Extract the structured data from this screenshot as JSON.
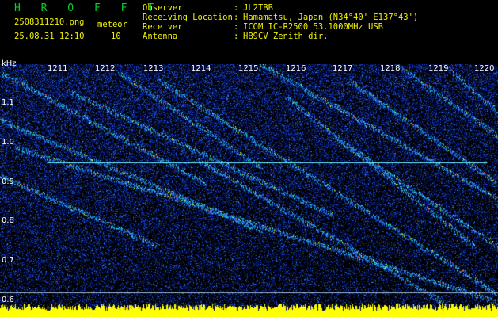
{
  "header": {
    "brand": "H R O F F T",
    "filename": "2508311210.png",
    "detection_label": "meteor",
    "timestamp": "25.08.31 12:10",
    "detection_count": "10",
    "fields": [
      {
        "key": "Observer",
        "sep": ":",
        "value": "JL2TBB"
      },
      {
        "key": "Receiving Location",
        "sep": ":",
        "value": "Hamamatsu, Japan (N34°40' E137°43')"
      },
      {
        "key": "Receiver",
        "sep": ":",
        "value": "ICOM IC-R2500 53.1000MHz USB"
      },
      {
        "key": "Antenna",
        "sep": ":",
        "value": "HB9CV Zenith dir."
      }
    ]
  },
  "spectrogram": {
    "y_unit": "kHz",
    "y_ticks": [
      "1.1",
      "1.0",
      "0.9",
      "0.8",
      "0.7",
      "0.6"
    ],
    "time_ticks": [
      "1211",
      "1212",
      "1213",
      "1214",
      "1215",
      "1216",
      "1217",
      "1218",
      "1219",
      "1220"
    ],
    "colors": {
      "background": "#000000",
      "noise_low": "#0a1a6e",
      "noise_mid": "#1f4fd8",
      "signal": "#2ed1c8",
      "signal_hot": "#e8f020",
      "peak": "#ff3a2a",
      "reference_line": "#6ff0ff",
      "bottom_band": "#ffff00"
    }
  }
}
